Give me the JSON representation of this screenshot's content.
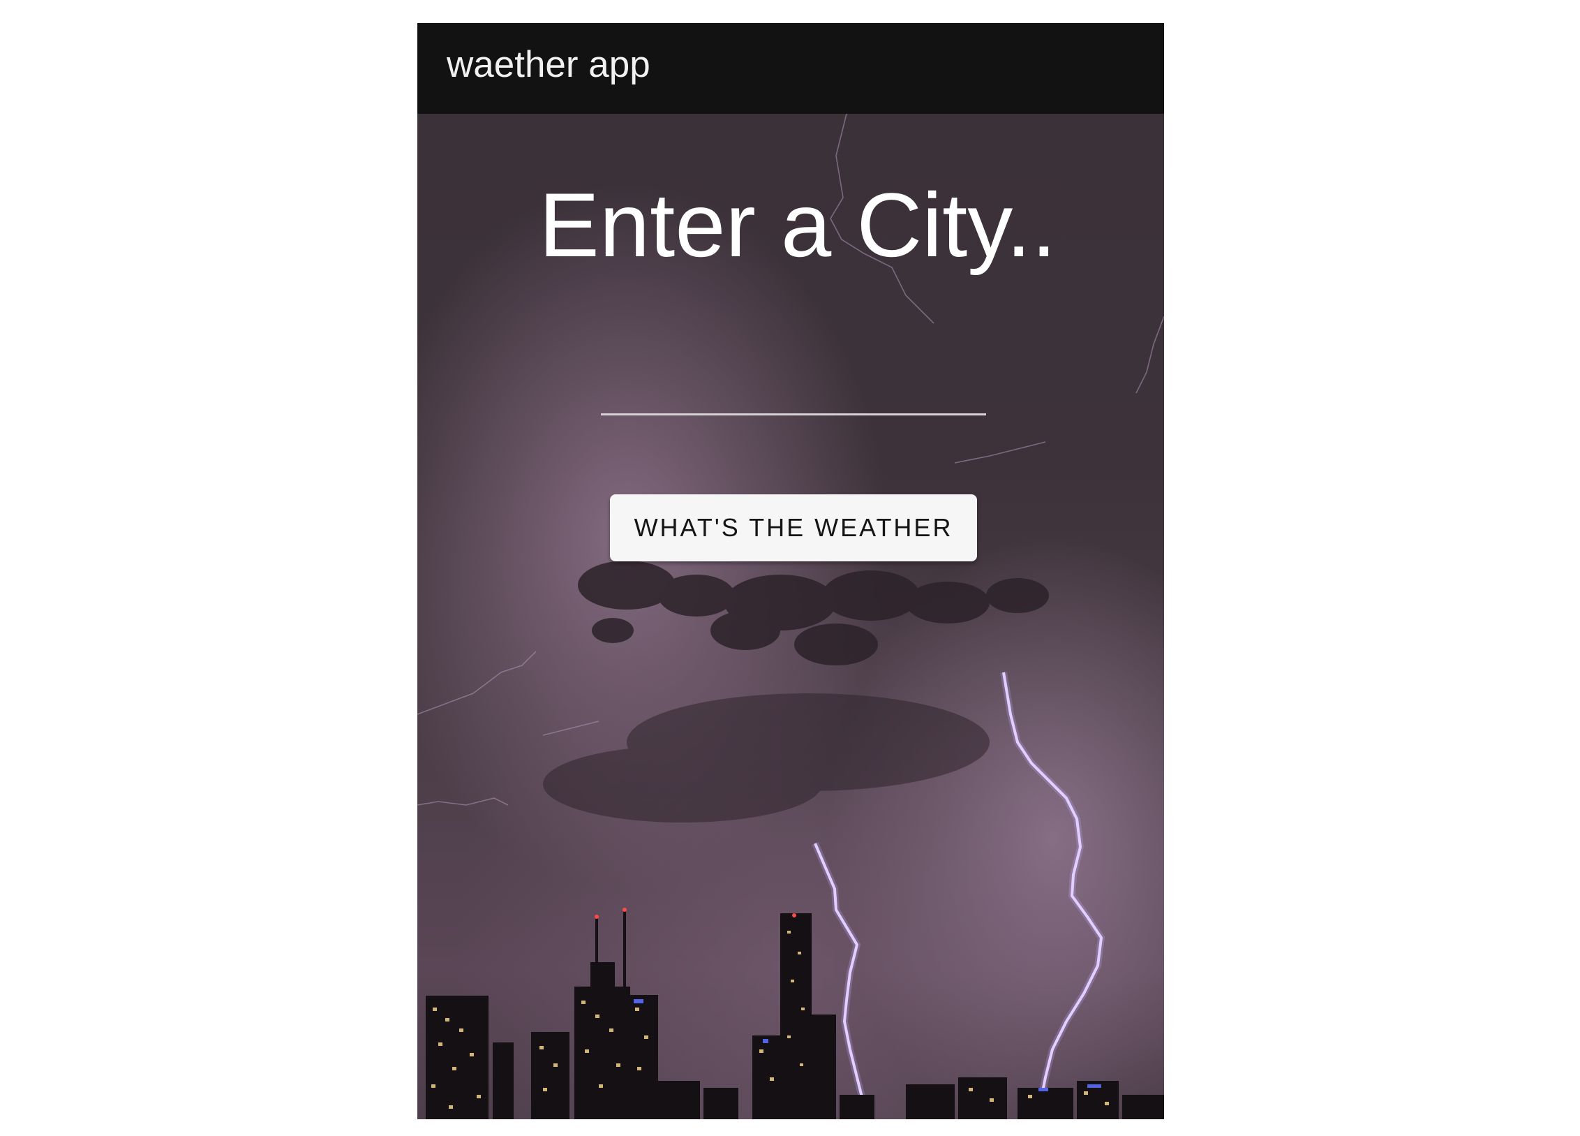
{
  "app_bar": {
    "title": "waether app"
  },
  "main": {
    "heading": "Enter a City..",
    "city_input": {
      "value": "",
      "placeholder": ""
    },
    "submit_label": "WHAT'S THE WEATHER"
  },
  "colors": {
    "app_bar_bg": "#121212",
    "sky_top": "#3b3139",
    "sky_glow": "#8c6f88",
    "lightning": "#e9dcff",
    "button_bg": "#f7f6f7"
  }
}
